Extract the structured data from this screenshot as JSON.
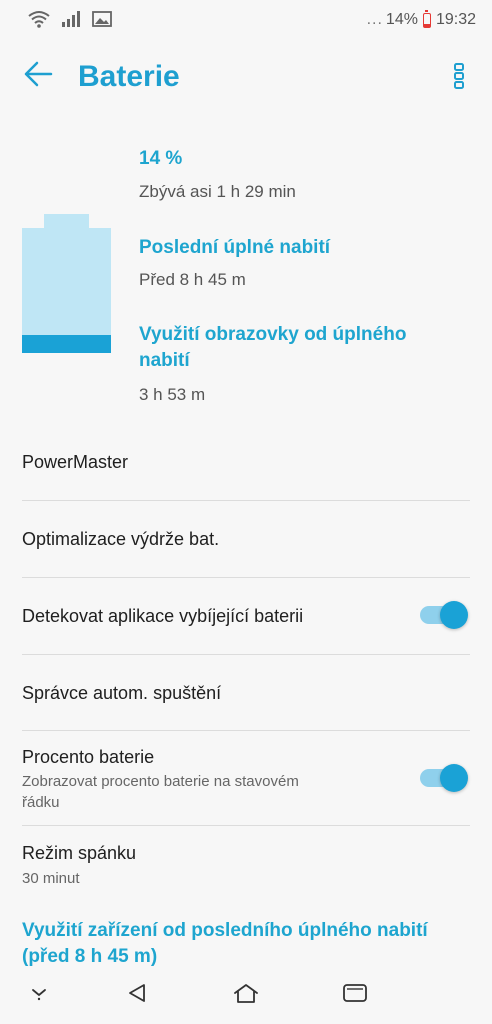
{
  "status_bar": {
    "more": "...",
    "battery_percent": "14%",
    "time": "19:32"
  },
  "app_bar": {
    "title": "Baterie"
  },
  "summary": {
    "percent": "14 %",
    "remaining": "Zbývá asi 1 h 29 min",
    "last_full_charge_label": "Poslední úplné nabití",
    "last_full_charge_value": "Před 8 h 45 m",
    "screen_usage_label": "Využití obrazovky od úplného nabití",
    "screen_usage_value": "3 h 53 m",
    "battery_level": 0.14
  },
  "settings": {
    "powermaster": "PowerMaster",
    "optimize": "Optimalizace výdrže bat.",
    "detect_drain": {
      "label": "Detekovat aplikace vybíjející baterii",
      "enabled": true
    },
    "autostart": "Správce autom. spuštění",
    "battery_percentage": {
      "label": "Procento baterie",
      "description": "Zobrazovat procento baterie na stavovém řádku",
      "enabled": true
    },
    "sleep_mode": {
      "label": "Režim spánku",
      "value": "30 minut"
    }
  },
  "usage_section": {
    "title": "Využití zařízení od posledního úplného nabití (před 8 h 45 m)"
  },
  "colors": {
    "accent": "#1ea5cf",
    "battery_fill": "#1aa2d6",
    "battery_empty": "#bfe6f5",
    "background": "#f7f7f7"
  }
}
